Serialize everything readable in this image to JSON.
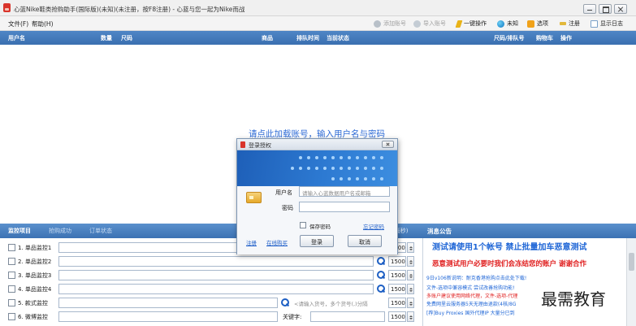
{
  "window": {
    "title": "心蓝Nike鞋类抢购助手(国际版)(未知)(未注册，按F8注册) - 心蓝与您一起为Nike而战"
  },
  "menu": {
    "file": "文件(F)",
    "help": "帮助(H)"
  },
  "toolbar": {
    "add_account": "添加账号",
    "import_account": "导入账号",
    "one_key": "一键操作",
    "unknown": "未知",
    "options": "选项",
    "register": "注册",
    "show_log": "显示日志"
  },
  "grid": {
    "columns": [
      "用户名",
      "数量",
      "尺码",
      "商品",
      "排队时间",
      "当前状态",
      "尺码/排队号",
      "购物车",
      "操作"
    ],
    "empty_hint": "请点此加载账号，输入用户名与密码"
  },
  "monitor": {
    "tabs": [
      "监控项目",
      "抢购成功",
      "订单状态"
    ],
    "interval_label": "(毫秒)",
    "rows": [
      {
        "label": "1. 单品监控1",
        "value": "1500"
      },
      {
        "label": "2. 单品监控2",
        "value": "1500"
      },
      {
        "label": "3. 单品监控3",
        "value": "1500"
      },
      {
        "label": "4. 单品监控4",
        "value": "1500"
      },
      {
        "label": "5. 款式监控",
        "value": "1500",
        "placeholder": "<请输入货号，多个货号(,)分隔"
      },
      {
        "label": "6. 微博监控",
        "value": "1500",
        "keyword_label": "关键字:"
      }
    ]
  },
  "announcement": {
    "title": "消息公告",
    "notice_blue": "测试请使用1个帐号 禁止批量加车恶意测试",
    "notice_red": "恶意测试用户必要时我们会冻结您的账户 谢谢合作",
    "lines": [
      {
        "text": "9日v106新说明：耐克香港抢购点击此处下载!",
        "color": "#1f66d6"
      },
      {
        "text": "文件-选项中兼容模式 尝试改善抢购功能!",
        "color": "#1f66d6"
      },
      {
        "text": "多账户建议使用网络代理，文件-选项-代理",
        "color": "#e02020"
      },
      {
        "text": "免费网里云服务器5天无理由退款(4核/8G",
        "color": "#1f66d6"
      },
      {
        "text": "[荐]Buy Proxies 国外代理IP 大量分已到",
        "color": "#1f66d6"
      }
    ]
  },
  "login_dialog": {
    "title": "登录授权",
    "username_label": "用户名",
    "username_placeholder": "请输入心蓝数据用户名或邮箱",
    "password_label": "密码",
    "remember_label": "保存密码",
    "forgot_link": "忘记密码",
    "register_link": "注册",
    "online_recharge_link": "在线购买",
    "login_button": "登录",
    "cancel_button": "取消"
  },
  "watermark": "最需教育",
  "colors": {
    "header_blue": "#3a6fb0",
    "hint_blue": "#2c6ad6",
    "notice_red": "#e02020",
    "link_blue": "#1f5fc9"
  }
}
